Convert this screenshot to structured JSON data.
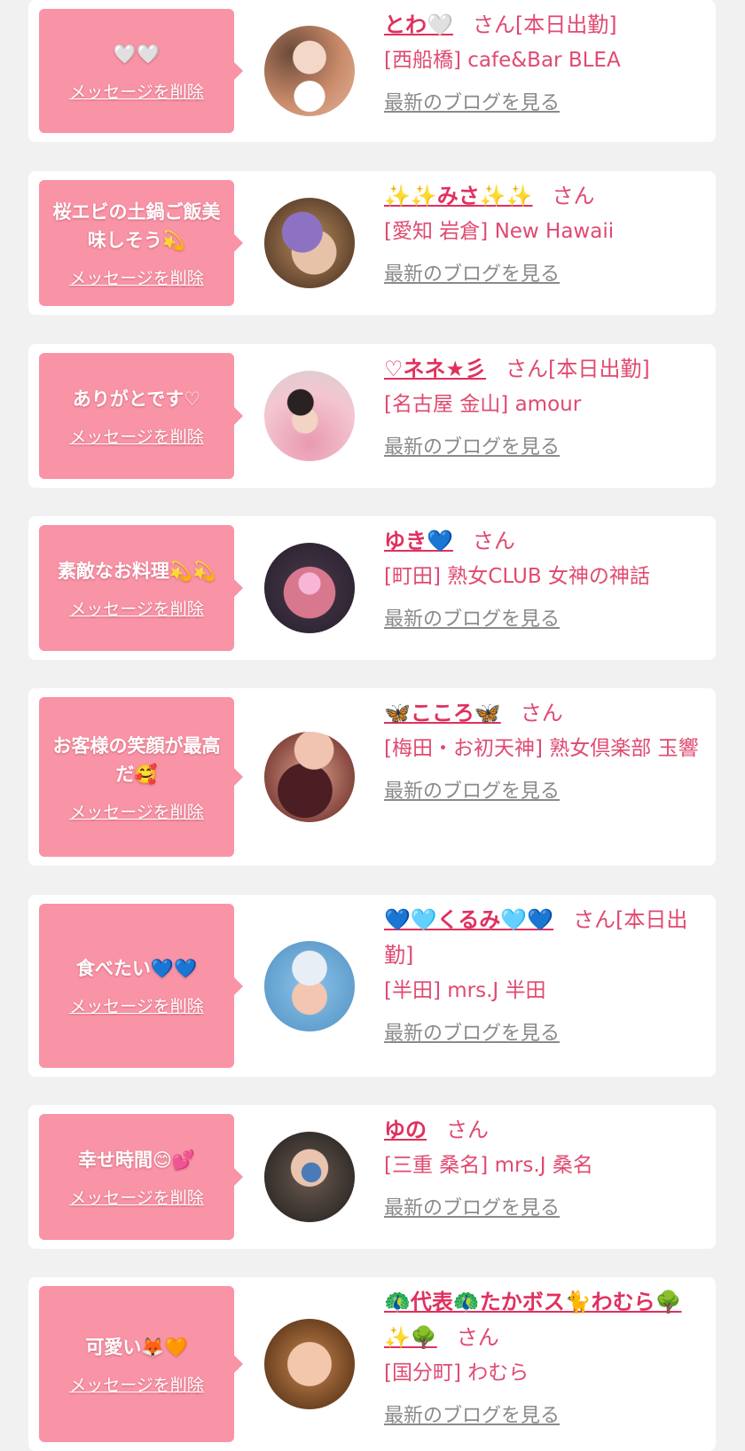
{
  "delete_label": "メッセージを削除",
  "blog_label": "最新のブログを見る",
  "colors": {
    "bubble": "#f993a6",
    "accent": "#e0305e",
    "text": "#e04a70",
    "blog_link": "#8a8a8a",
    "background": "#f1f1f1"
  },
  "entries": [
    {
      "message": "🤍🤍",
      "name": "とわ🤍",
      "suffix": "さん[本日出勤]",
      "shop": "[西船橋] cafe&Bar BLEA"
    },
    {
      "message": "桜エビの土鍋ご飯美味しそう💫",
      "name": "✨✨みさ✨✨",
      "suffix": "さん",
      "shop": "[愛知 岩倉] New Hawaii"
    },
    {
      "message": "ありがとです♡",
      "name": "♡ネネ★彡",
      "suffix": "さん[本日出勤]",
      "shop": "[名古屋 金山] amour"
    },
    {
      "message": "素敵なお料理💫💫",
      "name": "ゆき💙",
      "suffix": "さん",
      "shop": "[町田] 熟女CLUB 女神の神話"
    },
    {
      "message": "お客様の笑顔が最高だ🥰",
      "name": "🦋こころ🦋",
      "suffix": "さん",
      "shop": "[梅田・お初天神] 熟女倶楽部 玉響"
    },
    {
      "message": "食べたい💙💙",
      "name": "💙🩵くるみ🩵💙",
      "suffix": "さん[本日出勤]",
      "shop": "[半田] mrs.J 半田"
    },
    {
      "message": "幸せ時間😊💕",
      "name": "ゆの",
      "suffix": "さん",
      "shop": "[三重 桑名] mrs.J 桑名"
    },
    {
      "message": "可愛い🦊🧡",
      "name": "🦚代表🦚たかボス🐈わむら🌳✨🌳",
      "suffix": "さん",
      "shop": "[国分町] わむら"
    }
  ]
}
